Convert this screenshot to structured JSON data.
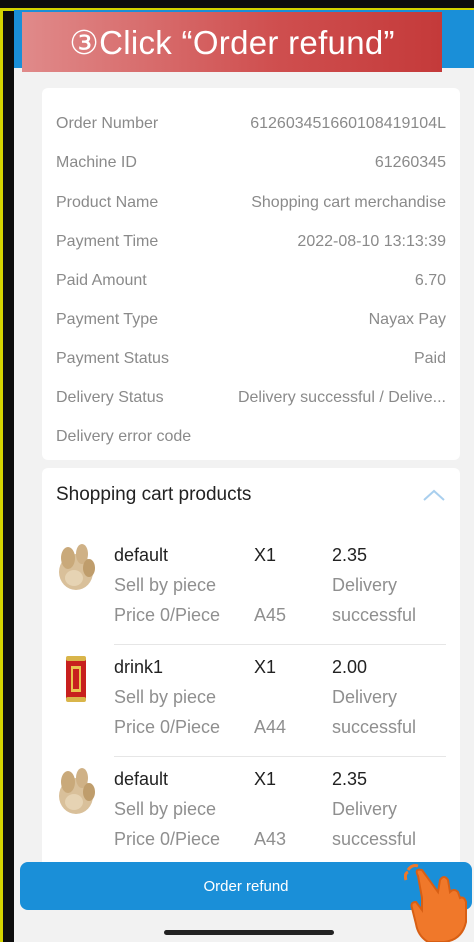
{
  "banner": {
    "text": "③Click “Order refund”"
  },
  "order_info": {
    "rows": [
      {
        "label": "Order Number",
        "value": "61260345166010841910 4L"
      },
      {
        "label": "Machine ID",
        "value": "61260345"
      },
      {
        "label": "Product Name",
        "value": "Shopping cart merchandise"
      },
      {
        "label": "Payment Time",
        "value": "2022-08-10 13:13:39"
      },
      {
        "label": "Paid Amount",
        "value": "6.70"
      },
      {
        "label": "Payment Type",
        "value": "Nayax Pay"
      },
      {
        "label": "Payment Status",
        "value": "Paid"
      },
      {
        "label": "Delivery Status",
        "value": "Delivery successful / Delive..."
      },
      {
        "label": "Delivery error code",
        "value": ""
      }
    ]
  },
  "cart": {
    "title": "Shopping cart products",
    "items": [
      {
        "name": "default",
        "sell": "Sell by piece",
        "price": "Price 0/Piece",
        "qty": "X1",
        "slot": "A45",
        "amount": "2.35",
        "status1": "Delivery",
        "status2": "successful",
        "icon": "ginger-icon"
      },
      {
        "name": "drink1",
        "sell": "Sell by piece",
        "price": "Price 0/Piece",
        "qty": "X1",
        "slot": "A44",
        "amount": "2.00",
        "status1": "Delivery",
        "status2": "successful",
        "icon": "can-icon"
      },
      {
        "name": "default",
        "sell": "Sell by piece",
        "price": "Price 0/Piece",
        "qty": "X1",
        "slot": "A43",
        "amount": "2.35",
        "status1": "Delivery",
        "status2": "successful",
        "icon": "ginger-icon"
      }
    ]
  },
  "actions": {
    "refund_label": "Order refund"
  },
  "colors": {
    "primary": "#1a8fd8",
    "banner": "#cf4f4f"
  }
}
